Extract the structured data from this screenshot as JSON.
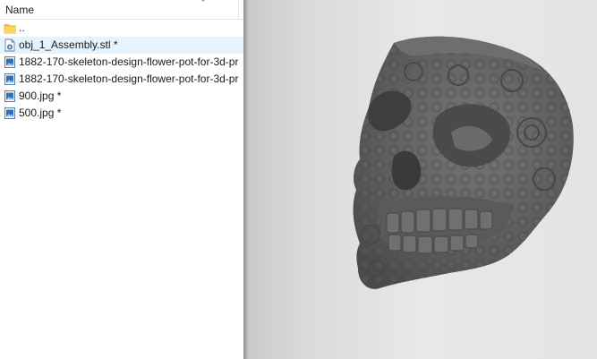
{
  "file_list": {
    "column_header": "Name",
    "items": [
      {
        "name": "..",
        "icon": "folder-icon"
      },
      {
        "name": "obj_1_Assembly.stl *",
        "icon": "stl-file-icon"
      },
      {
        "name": "1882-170-skeleton-design-flower-pot-for-3d-pr",
        "icon": "image-file-icon"
      },
      {
        "name": "1882-170-skeleton-design-flower-pot-for-3d-pr",
        "icon": "image-file-icon"
      },
      {
        "name": "900.jpg *",
        "icon": "image-file-icon"
      },
      {
        "name": "500.jpg *",
        "icon": "image-file-icon"
      }
    ]
  },
  "viewport": {
    "model": "skull-flower-pot-3d-model",
    "model_color": "#5e5e5e",
    "background_color": "#e6e6e6"
  }
}
